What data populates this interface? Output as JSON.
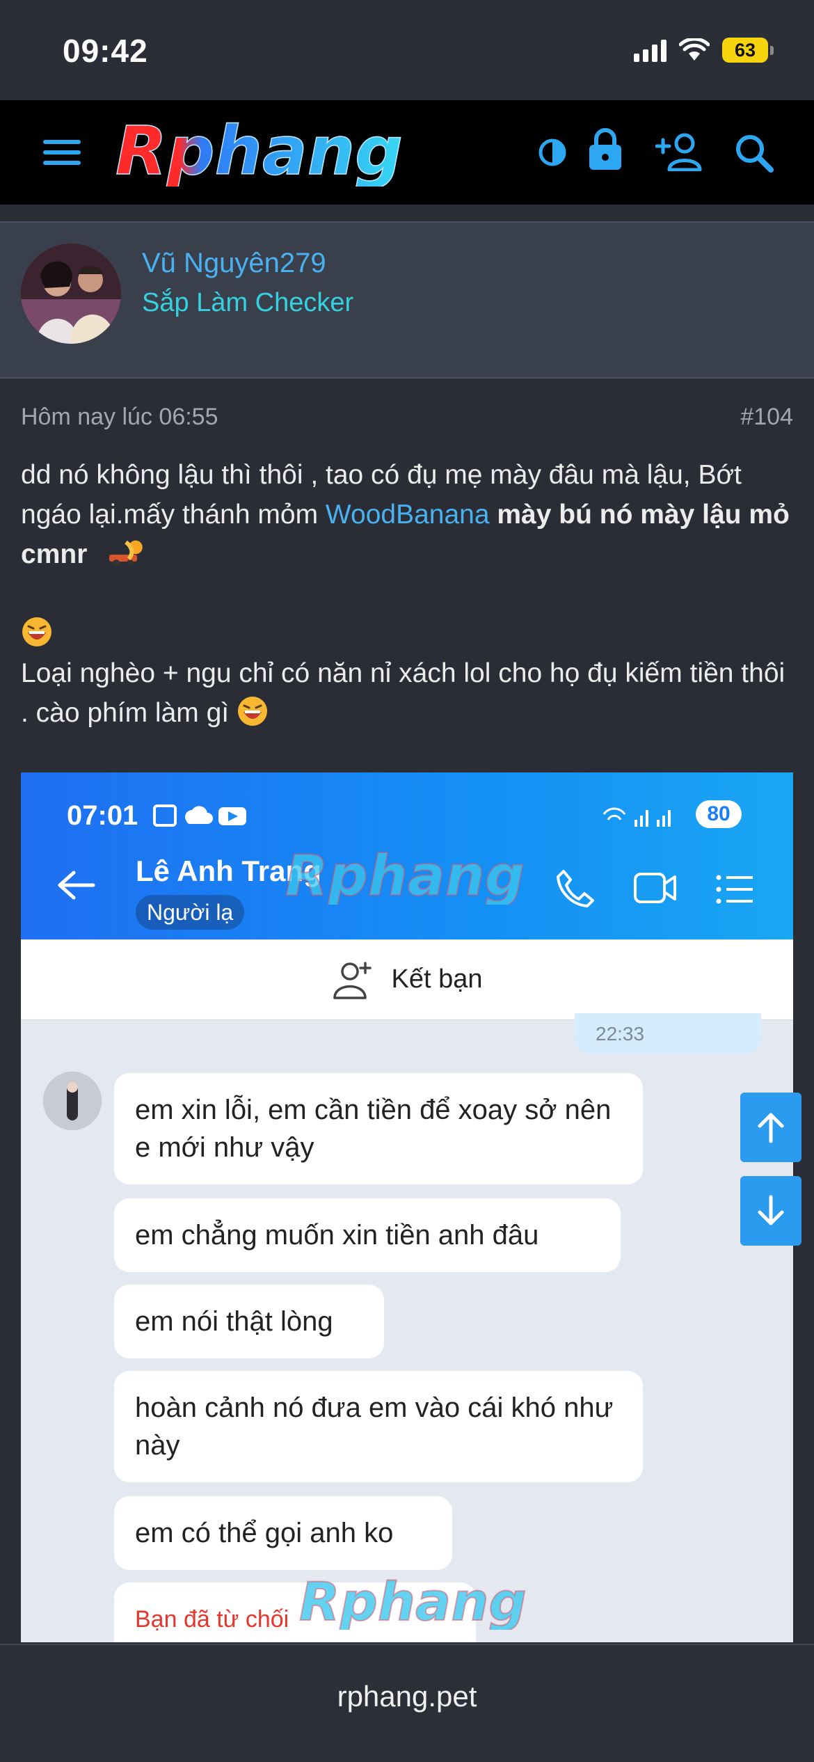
{
  "status_bar": {
    "time": "09:42",
    "battery": "63",
    "icons": [
      "cellular-signal-icon",
      "wifi-icon",
      "battery-icon"
    ]
  },
  "header": {
    "logo_text": "Rphang",
    "icons": [
      "menu-icon",
      "theme-toggle-icon",
      "lock-icon",
      "add-user-icon",
      "search-icon"
    ]
  },
  "post": {
    "author": "Vũ Nguyên279",
    "author_title": "Sắp Làm Checker",
    "timestamp": "Hôm nay lúc 06:55",
    "number": "#104",
    "line1": "dd nó không lậu thì thôi , tao có đụ mẹ mày đâu mà lậu, Bớt ngáo lại.mấy thánh mỏm ",
    "mention": "WoodBanana",
    "bold_text": " mày bú nó mày lậu mỏ cmnr",
    "line2": "Loại nghèo + ngu chỉ có năn nỉ xách lol cho họ đụ kiếm tiền thôi . cào phím làm gì"
  },
  "attachment": {
    "time": "07:01",
    "battery": "80",
    "contact_name": "Lê Anh Trang",
    "contact_badge": "Người lạ",
    "add_friend": "Kết bạn",
    "last_time": "22:33",
    "messages": [
      "em xin lỗi, em cần tiền để xoay sở nên e mới như vậy",
      "em chẳng muốn xin tiền anh đâu",
      "em nói thật lòng",
      "hoàn cảnh nó đưa em vào cái khó như này",
      "em có thể gọi anh ko"
    ],
    "declined": "Bạn đã từ chối",
    "watermark": "Rphang"
  },
  "footer": {
    "url": "rphang.pet"
  },
  "colors": {
    "accent": "#4ab1f0",
    "title": "#36d1e0",
    "background": "#2a2d36",
    "zalo_blue": "#1a8cf4"
  }
}
